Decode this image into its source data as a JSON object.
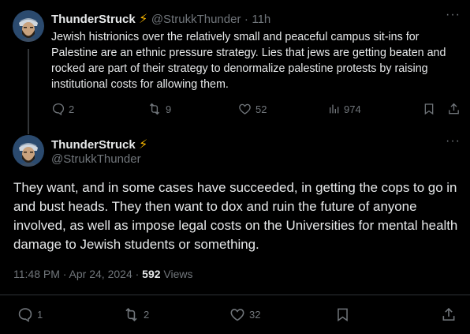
{
  "reply_tweet": {
    "display_name": "ThunderStruck",
    "badge": "⚡",
    "handle": "@StrukkThunder",
    "separator": "·",
    "time": "11h",
    "text": "Jewish histrionics over the relatively small and peaceful campus sit-ins for Palestine are an ethnic pressure strategy. Lies that jews are getting beaten and rocked are part of their strategy to denormalize palestine protests by raising institutional costs for allowing them.",
    "metrics": {
      "replies": "2",
      "reposts": "9",
      "likes": "52",
      "views": "974"
    }
  },
  "main_tweet": {
    "display_name": "ThunderStruck",
    "badge": "⚡",
    "handle": "@StrukkThunder",
    "text": "They want, and in some cases have succeeded, in getting the cops to go in and bust heads. They then want to dox and ruin the future of anyone involved, as well as impose legal costs on the Universities for mental health damage to Jewish students or something.",
    "timestamp": "11:48 PM · Apr 24, 2024 ·",
    "views_count": "592",
    "views_label": "Views",
    "metrics": {
      "replies": "1",
      "reposts": "2",
      "likes": "32"
    }
  },
  "colors": {
    "background": "#000000",
    "text": "#e7e9ea",
    "muted": "#71767b",
    "bolt": "#f7b500"
  },
  "icons": [
    "reply-icon",
    "repost-icon",
    "like-icon",
    "views-icon",
    "bookmark-icon",
    "share-icon",
    "more-icon"
  ]
}
